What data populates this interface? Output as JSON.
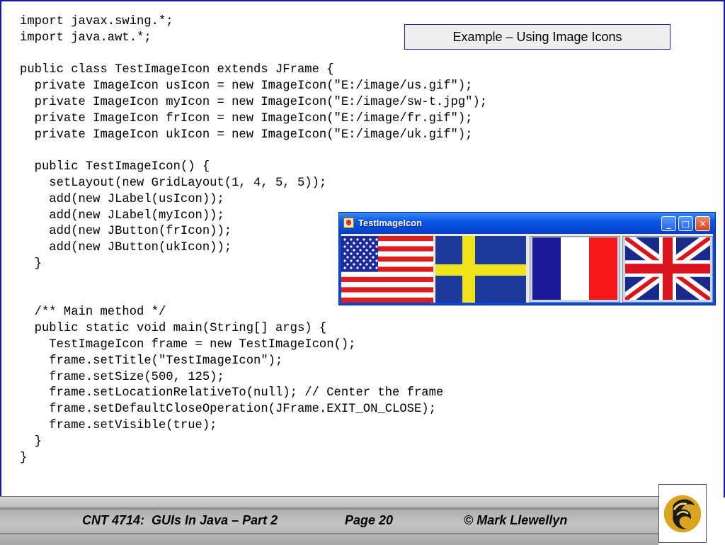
{
  "slide": {
    "title": "Example – Using Image Icons",
    "code_lines": [
      "import javax.swing.*;",
      "import java.awt.*;",
      "",
      "public class TestImageIcon extends JFrame {",
      "  private ImageIcon usIcon = new ImageIcon(\"E:/image/us.gif\");",
      "  private ImageIcon myIcon = new ImageIcon(\"E:/image/sw-t.jpg\");",
      "  private ImageIcon frIcon = new ImageIcon(\"E:/image/fr.gif\");",
      "  private ImageIcon ukIcon = new ImageIcon(\"E:/image/uk.gif\");",
      "",
      "  public TestImageIcon() {",
      "    setLayout(new GridLayout(1, 4, 5, 5));",
      "    add(new JLabel(usIcon));",
      "    add(new JLabel(myIcon));",
      "    add(new JButton(frIcon));",
      "    add(new JButton(ukIcon));",
      "  }",
      "",
      "",
      "  /** Main method */",
      "  public static void main(String[] args) {",
      "    TestImageIcon frame = new TestImageIcon();",
      "    frame.setTitle(\"TestImageIcon\");",
      "    frame.setSize(500, 125);",
      "    frame.setLocationRelativeTo(null); // Center the frame",
      "    frame.setDefaultCloseOperation(JFrame.EXIT_ON_CLOSE);",
      "    frame.setVisible(true);",
      "  }",
      "}"
    ]
  },
  "java_window": {
    "title": "TestImageIcon",
    "icons": {
      "app": "java-cup-icon",
      "minimize": "minimize-icon",
      "maximize": "maximize-icon",
      "close": "close-icon"
    },
    "flags": [
      "us-flag",
      "sweden-flag",
      "france-flag",
      "uk-flag"
    ]
  },
  "footer": {
    "course": "CNT 4714:  GUIs In Java – Part 2",
    "page": "Page 20",
    "author": "© Mark Llewellyn"
  },
  "colors": {
    "border_blue": "#1a1aa8",
    "title_box_bg": "#eeeeee",
    "xp_titlebar": "#0a58e6"
  }
}
